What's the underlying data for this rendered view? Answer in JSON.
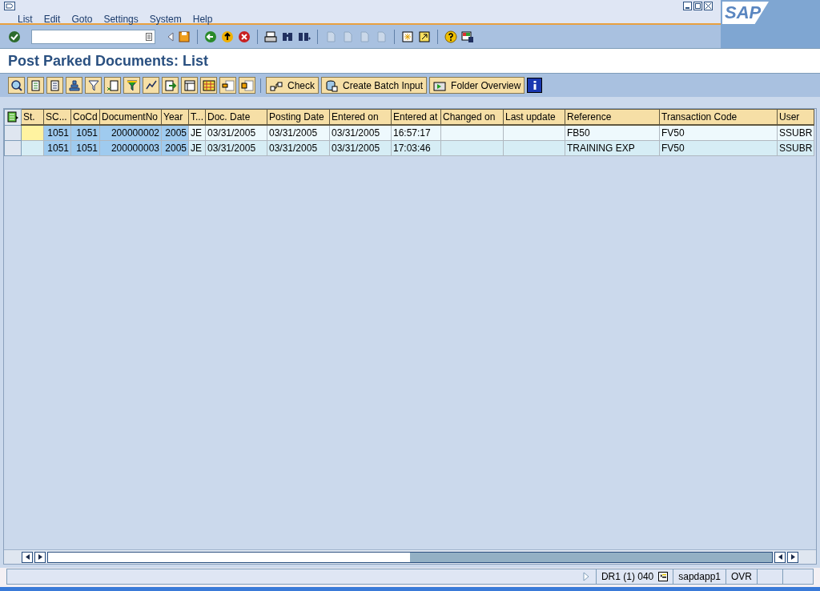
{
  "logo": "SAP",
  "menu": [
    "List",
    "Edit",
    "Goto",
    "Settings",
    "System",
    "Help"
  ],
  "title": "Post Parked Documents: List",
  "app_buttons": [
    "Check",
    "Create Batch Input",
    "Folder Overview"
  ],
  "table": {
    "columns": [
      {
        "label": "St.",
        "key": false
      },
      {
        "label": "SC...",
        "key": true
      },
      {
        "label": "CoCd",
        "key": true
      },
      {
        "label": "DocumentNo",
        "key": true
      },
      {
        "label": "Year",
        "key": true
      },
      {
        "label": "T...",
        "key": false
      },
      {
        "label": "Doc. Date",
        "key": false
      },
      {
        "label": "Posting Date",
        "key": false
      },
      {
        "label": "Entered on",
        "key": false
      },
      {
        "label": "Entered at",
        "key": false
      },
      {
        "label": "Changed on",
        "key": false
      },
      {
        "label": "Last update",
        "key": false
      },
      {
        "label": "Reference",
        "key": false
      },
      {
        "label": "Transaction Code",
        "key": false
      },
      {
        "label": "User",
        "key": false
      }
    ],
    "rows": [
      {
        "current": true,
        "cells": [
          "",
          "1051",
          "1051",
          "200000002",
          "2005",
          "JE",
          "03/31/2005",
          "03/31/2005",
          "03/31/2005",
          "16:57:17",
          "",
          "",
          "FB50",
          "FV50",
          "SSUBR"
        ]
      },
      {
        "current": false,
        "cells": [
          "",
          "1051",
          "1051",
          "200000003",
          "2005",
          "JE",
          "03/31/2005",
          "03/31/2005",
          "03/31/2005",
          "17:03:46",
          "",
          "",
          "TRAINING EXP",
          "FV50",
          "SSUBR"
        ]
      }
    ]
  },
  "status_bar": {
    "system": "DR1 (1) 040",
    "server": "sapdapp1",
    "mode": "OVR"
  }
}
